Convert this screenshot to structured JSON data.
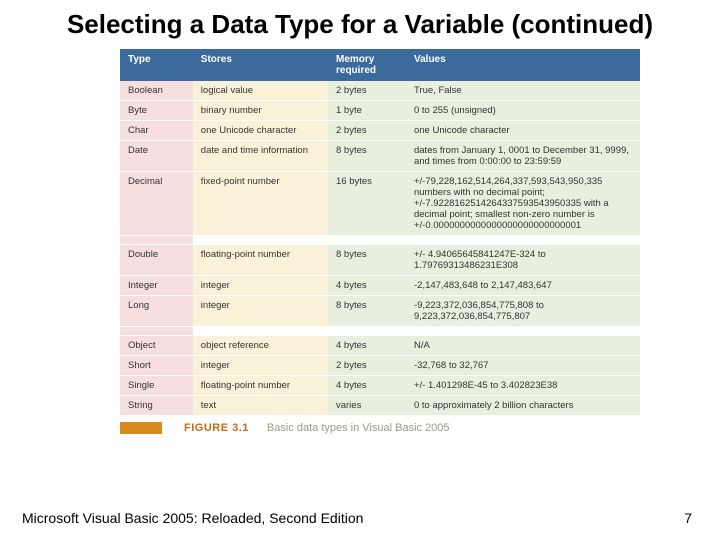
{
  "title": "Selecting a Data Type for a Variable (continued)",
  "table": {
    "headers": {
      "type": "Type",
      "stores": "Stores",
      "memory": "Memory required",
      "values": "Values"
    },
    "rows": [
      {
        "type": "Boolean",
        "stores": "logical value",
        "memory": "2 bytes",
        "values": "True, False"
      },
      {
        "type": "Byte",
        "stores": "binary number",
        "memory": "1 byte",
        "values": "0 to 255 (unsigned)"
      },
      {
        "type": "Char",
        "stores": "one Unicode character",
        "memory": "2 bytes",
        "values": "one Unicode character"
      },
      {
        "type": "Date",
        "stores": "date and time information",
        "memory": "8 bytes",
        "values": "dates from January 1, 0001 to December 31, 9999, and times from 0:00:00 to 23:59:59"
      },
      {
        "type": "Decimal",
        "stores": "fixed-point number",
        "memory": "16 bytes",
        "values": "+/-79,228,162,514,264,337,593,543,950,335 numbers with no decimal point; +/-7.9228162514264337593543950335 with a decimal point; smallest non-zero number is +/-0.0000000000000000000000000001"
      },
      {
        "type": "Double",
        "stores": "floating-point number",
        "memory": "8 bytes",
        "values": "+/- 4.94065645841247E-324 to 1.79769313486231E308"
      },
      {
        "type": "Integer",
        "stores": "integer",
        "memory": "4 bytes",
        "values": "-2,147,483,648 to 2,147,483,647"
      },
      {
        "type": "Long",
        "stores": "integer",
        "memory": "8 bytes",
        "values": "-9,223,372,036,854,775,808 to 9,223,372,036,854,775,807"
      },
      {
        "type": "Object",
        "stores": "object reference",
        "memory": "4 bytes",
        "values": "N/A"
      },
      {
        "type": "Short",
        "stores": "integer",
        "memory": "2 bytes",
        "values": "-32,768 to 32,767"
      },
      {
        "type": "Single",
        "stores": "floating-point number",
        "memory": "4 bytes",
        "values": "+/- 1.401298E-45 to 3.402823E38"
      },
      {
        "type": "String",
        "stores": "text",
        "memory": "varies",
        "values": "0 to approximately 2 billion characters"
      }
    ]
  },
  "figure": {
    "label": "FIGURE 3.1",
    "desc": "Basic data types in Visual Basic 2005"
  },
  "footer": {
    "left": "Microsoft Visual Basic 2005: Reloaded, Second Edition",
    "page": "7"
  },
  "colors": {
    "header_bg": "#3b6a9c",
    "type_col_bg": "#f7dfe0",
    "stores_col_bg": "#faf1d9",
    "memval_col_bg": "#e8efde",
    "accent": "#d98a1f"
  }
}
